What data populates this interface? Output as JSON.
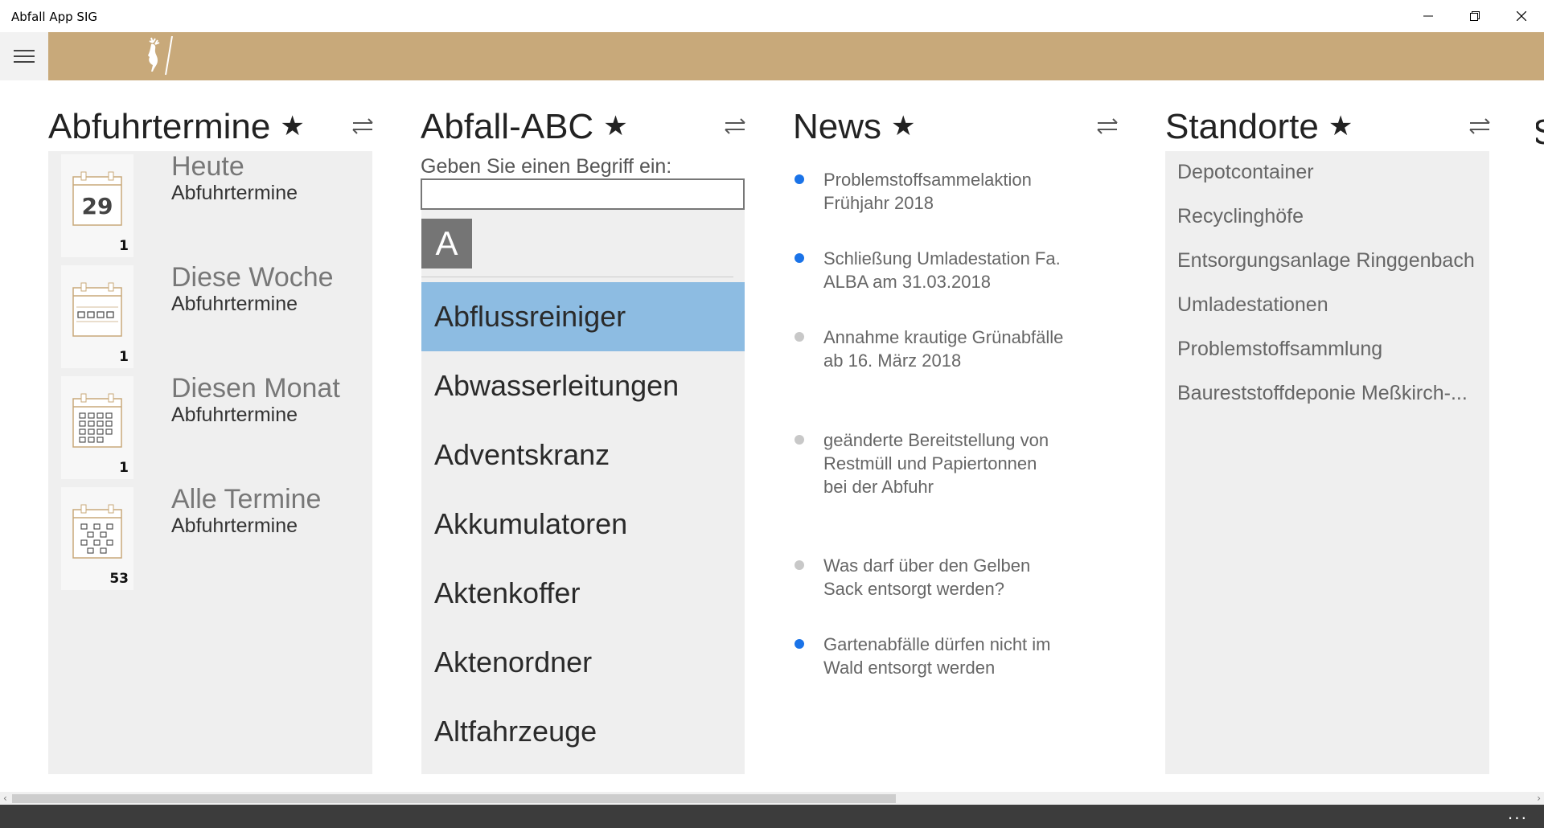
{
  "window": {
    "title": "Abfall App SIG",
    "minimize_icon": "minimize-icon",
    "maximize_icon": "restore-icon",
    "close_icon": "close-icon"
  },
  "header": {
    "menu_icon": "hamburger-icon",
    "logo_icon": "deer-logo-icon",
    "bg_color": "#c8a97a"
  },
  "panels": {
    "abfuhrtermine": {
      "title": "Abfuhrtermine",
      "star": "★",
      "tiles": [
        {
          "name": "Heute",
          "sub": "Abfuhrtermine",
          "count": "1",
          "icon_day": "29"
        },
        {
          "name": "Diese Woche",
          "sub": "Abfuhrtermine",
          "count": "1"
        },
        {
          "name": "Diesen Monat",
          "sub": "Abfuhrtermine",
          "count": "1"
        },
        {
          "name": "Alle Termine",
          "sub": "Abfuhrtermine",
          "count": "53"
        }
      ]
    },
    "abc": {
      "title": "Abfall-ABC",
      "star": "★",
      "prompt": "Geben Sie einen Begriff ein:",
      "input_value": "",
      "letter": "A",
      "items": [
        "Abflussreiniger",
        "Abwasserleitungen",
        "Adventskranz",
        "Akkumulatoren",
        "Aktenkoffer",
        "Aktenordner",
        "Altfahrzeuge"
      ],
      "selected_index": 0,
      "selected_color": "#8dbce2"
    },
    "news": {
      "title": "News",
      "star": "★",
      "items": [
        {
          "text": "Problemstoffsammelaktion Frühjahr 2018",
          "unread": true
        },
        {
          "text": "Schließung Umladestation Fa. ALBA am 31.03.2018",
          "unread": true
        },
        {
          "text": "Annahme krautige Grünabfälle ab 16. März 2018",
          "unread": false
        },
        {
          "text": "geänderte Bereitstellung von Restmüll und Papiertonnen bei der Abfuhr",
          "unread": false
        },
        {
          "text": "Was darf über den Gelben Sack entsorgt werden?",
          "unread": false
        },
        {
          "text": "Gartenabfälle dürfen nicht im Wald entsorgt werden",
          "unread": true
        }
      ],
      "unread_color": "#1a73e8",
      "read_color": "#c8c8c8"
    },
    "standorte": {
      "title": "Standorte",
      "star": "★",
      "items": [
        "Depotcontainer",
        "Recyclinghöfe",
        "Entsorgungsanlage Ringgenbach",
        "Umladestationen",
        "Problemstoffsammlung",
        "Baureststoffdeponie Meßkirch-..."
      ]
    }
  },
  "bottom": {
    "more": "..."
  }
}
